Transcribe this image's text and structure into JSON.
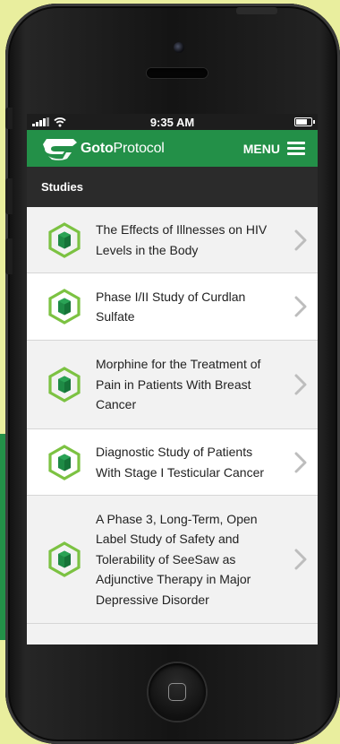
{
  "status_bar": {
    "time": "9:35 AM"
  },
  "header": {
    "logo_bold": "Goto",
    "logo_light": "Protocol",
    "menu_label": "MENU",
    "brand_color": "#239048"
  },
  "section": {
    "title": "Studies"
  },
  "studies": [
    {
      "title": "The Effects of Illnesses on HIV Levels in the Body"
    },
    {
      "title": "Phase I/II Study of Curdlan Sulfate"
    },
    {
      "title": "Morphine for the Treatment of Pain in Patients With Breast Cancer"
    },
    {
      "title": "Diagnostic Study of Patients With Stage I Testicular Cancer"
    },
    {
      "title": "A Phase 3, Long-Term, Open Label Study of Safety and Tolerability of SeeSaw as Adjunctive Therapy in Major Depressive Disorder"
    }
  ],
  "icons": {
    "study_icon": "hexagon-study-icon",
    "chevron": "chevron-right-icon",
    "menu": "hamburger-menu-icon"
  }
}
